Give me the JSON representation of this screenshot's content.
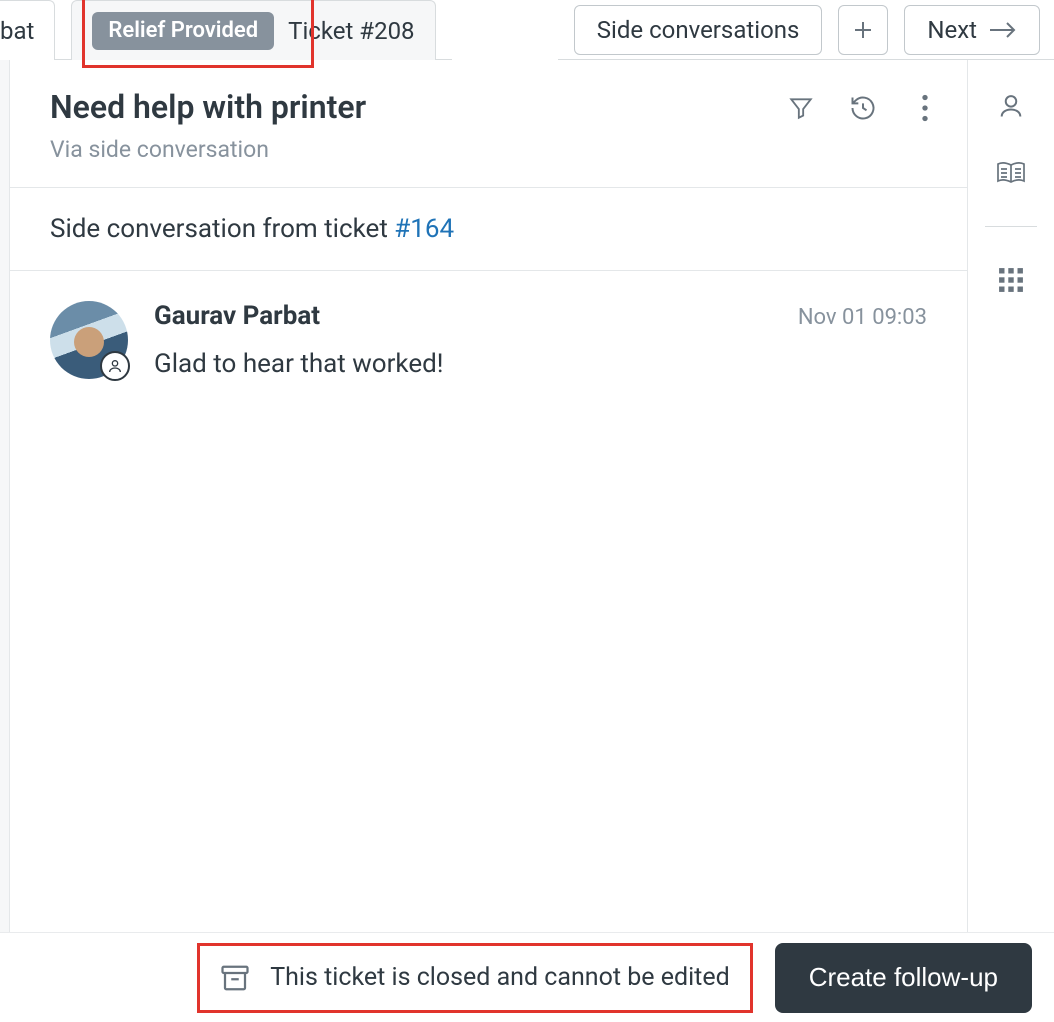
{
  "tabs": {
    "partial_left": "bat",
    "active": {
      "badge": "Relief Provided",
      "label": "Ticket #208"
    }
  },
  "toolbar": {
    "side_conversations_label": "Side conversations",
    "next_label": "Next"
  },
  "header": {
    "title": "Need help with printer",
    "subtitle": "Via side conversation"
  },
  "link_row": {
    "prefix": "Side conversation from ticket ",
    "ticket_link": "#164"
  },
  "message": {
    "author": "Gaurav Parbat",
    "time": "Nov 01 09:03",
    "text": "Glad to hear that worked!"
  },
  "footer": {
    "closed_text": "This ticket is closed and cannot be edited",
    "followup_label": "Create follow-up"
  }
}
